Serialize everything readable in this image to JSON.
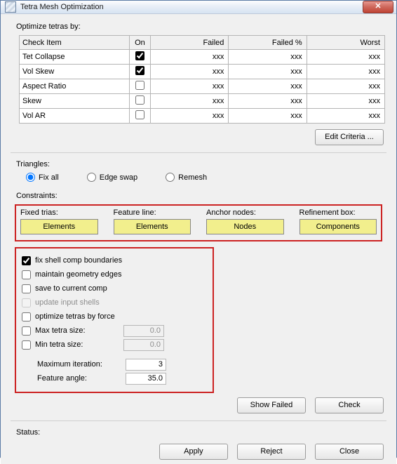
{
  "window": {
    "title": "Tetra Mesh Optimization"
  },
  "optimize_label": "Optimize tetras by:",
  "table": {
    "headers": {
      "check": "Check Item",
      "on": "On",
      "failed": "Failed",
      "failed_pct": "Failed %",
      "worst": "Worst"
    },
    "rows": [
      {
        "name": "Tet Collapse",
        "on": true,
        "failed": "xxx",
        "failed_pct": "xxx",
        "worst": "xxx"
      },
      {
        "name": "Vol Skew",
        "on": true,
        "failed": "xxx",
        "failed_pct": "xxx",
        "worst": "xxx"
      },
      {
        "name": "Aspect Ratio",
        "on": false,
        "failed": "xxx",
        "failed_pct": "xxx",
        "worst": "xxx"
      },
      {
        "name": "Skew",
        "on": false,
        "failed": "xxx",
        "failed_pct": "xxx",
        "worst": "xxx"
      },
      {
        "name": "Vol AR",
        "on": false,
        "failed": "xxx",
        "failed_pct": "xxx",
        "worst": "xxx"
      }
    ]
  },
  "edit_criteria": "Edit Criteria ...",
  "triangles_section": "Triangles:",
  "triangles": {
    "fix_all": "Fix all",
    "edge_swap": "Edge swap",
    "remesh": "Remesh",
    "selected": "fix_all"
  },
  "constraints_label": "Constraints:",
  "constraints": {
    "fixed_trias": {
      "label": "Fixed trias:",
      "button": "Elements"
    },
    "feature_line": {
      "label": "Feature line:",
      "button": "Elements"
    },
    "anchor_nodes": {
      "label": "Anchor nodes:",
      "button": "Nodes"
    },
    "refinement_box": {
      "label": "Refinement box:",
      "button": "Components"
    }
  },
  "options": {
    "fix_shell_comp_boundaries": {
      "label": "fix shell comp boundaries",
      "checked": true
    },
    "maintain_geometry_edges": {
      "label": "maintain geometry edges",
      "checked": false
    },
    "save_to_current_comp": {
      "label": "save to current comp",
      "checked": false
    },
    "update_input_shells": {
      "label": "update input shells",
      "checked": false,
      "disabled": true
    },
    "optimize_tetras_by_force": {
      "label": "optimize tetras by force",
      "checked": false
    },
    "max_tetra_size": {
      "label": "Max tetra size:",
      "checked": false,
      "value": "0.0"
    },
    "min_tetra_size": {
      "label": "Min tetra size:",
      "checked": false,
      "value": "0.0"
    },
    "maximum_iteration": {
      "label": "Maximum iteration:",
      "value": "3"
    },
    "feature_angle": {
      "label": "Feature angle:",
      "value": "35.0"
    }
  },
  "buttons": {
    "show_failed": "Show Failed",
    "check": "Check",
    "apply": "Apply",
    "reject": "Reject",
    "close": "Close"
  },
  "status_label": "Status:"
}
